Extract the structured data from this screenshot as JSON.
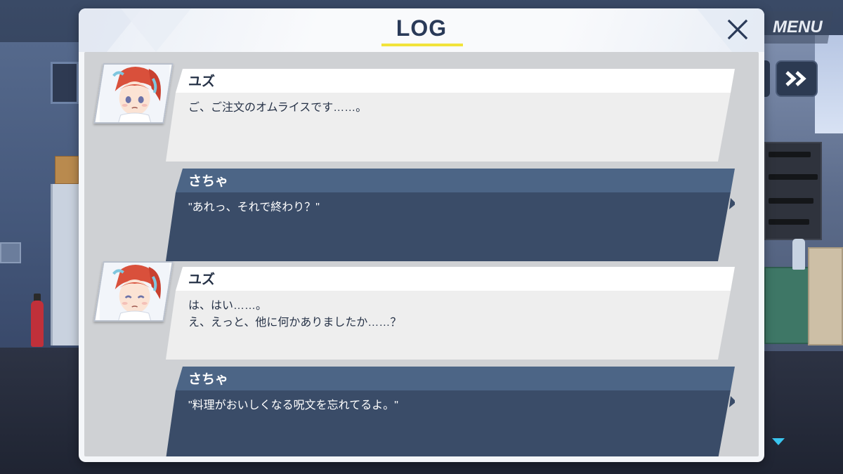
{
  "hud": {
    "menu_label": "MENU",
    "skip_icon": "double-chevron-right-icon",
    "scroll_icon": "triangle-down-icon"
  },
  "log": {
    "title": "LOG",
    "close_icon": "close-icon",
    "entries": [
      {
        "speaker": "ユズ",
        "text": "ご、ご注文のオムライスです……。",
        "type": "npc",
        "avatar": "yuzu-portrait"
      },
      {
        "speaker": "さちゃ",
        "text": "\"あれっ、それで終わり？\"",
        "type": "player"
      },
      {
        "speaker": "ユズ",
        "text": "は、はい……。\nえ、えっと、他に何かありましたか……？",
        "type": "npc",
        "avatar": "yuzu-portrait"
      },
      {
        "speaker": "さちゃ",
        "text": "\"料理がおいしくなる呪文を忘れてるよ。\"",
        "type": "player"
      }
    ]
  },
  "colors": {
    "npc_header": "#ffffff",
    "npc_body": "#eeeeee",
    "player_header": "#4c6586",
    "player_body": "#3a4c68",
    "title_underline": "#f1e33a",
    "title_text": "#2a3a58"
  }
}
